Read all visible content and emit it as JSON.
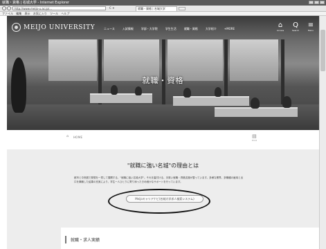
{
  "browser": {
    "window_title": "就職・資格 | 名城大学 - Internet Explorer",
    "url": "http://www.meijo-u.ac.jp/...",
    "url_tools": "C ✕",
    "tab_title": "就職・資格 | 名城大学",
    "menu": [
      "ファイル",
      "編集",
      "表示",
      "お気に入り",
      "ツール",
      "ヘルプ"
    ]
  },
  "site": {
    "logo_text": "MEIJO UNIVERSITY",
    "nav": [
      "ニュース",
      "入試情報",
      "学部・大学院",
      "学生生活",
      "就職・資格",
      "大学紹介",
      "+MORE"
    ],
    "header_icons": [
      {
        "glyph": "⌂",
        "label": "Access"
      },
      {
        "glyph": "Q",
        "label": "Search"
      },
      {
        "glyph": "≡",
        "label": "Menu"
      }
    ],
    "hero_title": "就職・資格"
  },
  "breadcrumb": {
    "home": "HOME",
    "print_label": "Print"
  },
  "main": {
    "heading": "\"就職に強い名城\"の理由とは",
    "body": "都市と中央圏で発想を一貫して展開する、\"就職に強い名城大学\"。それを裏付ける、手厚い就職・資格支援が整っています。多様な業界、多職種の雇用と出口を構築した結果の充実により、学生一人ひとりに寄り添ったきめ細かなサポートを行っています。",
    "cta_label": "Meijoキャリアナビ(名城大学求人検索システム)",
    "section_label": "就職・求人実績"
  }
}
